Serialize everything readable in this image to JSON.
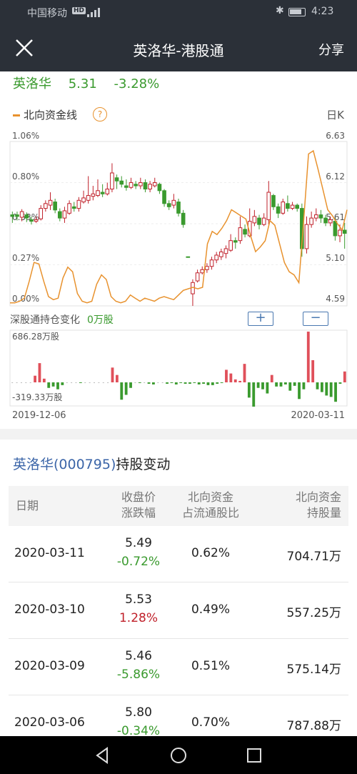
{
  "status_bar": {
    "carrier": "中国移动",
    "hd": "HD",
    "time": "4:23"
  },
  "nav": {
    "title": "英洛华-港股通",
    "share": "分享"
  },
  "quote": {
    "name": "英洛华",
    "price": "5.31",
    "change": "-3.28%"
  },
  "chart_header": {
    "line_label": "北向资金线",
    "help": "?",
    "period": "日K"
  },
  "colors": {
    "up": "#c0202a",
    "down": "#3a9a2e",
    "line": "#e8922e",
    "nav_bg": "#2b3038",
    "link": "#3b65a8"
  },
  "chart_data": [
    {
      "type": "candlestick",
      "left_axis_ticks": [
        "1.06%",
        "0.80%",
        "0.53%",
        "0.27%",
        "0.00%"
      ],
      "right_axis_ticks": [
        "6.63",
        "6.12",
        "5.61",
        "5.10",
        "4.59"
      ],
      "candles": [
        [
          5.7,
          5.72,
          5.62,
          5.76,
          -1
        ],
        [
          5.72,
          5.7,
          5.65,
          5.76,
          -1
        ],
        [
          5.69,
          5.76,
          5.64,
          5.79,
          1
        ],
        [
          5.72,
          5.68,
          5.63,
          5.75,
          -1
        ],
        [
          5.66,
          5.64,
          5.6,
          5.7,
          -1
        ],
        [
          5.64,
          5.66,
          5.62,
          5.7,
          1
        ],
        [
          5.67,
          5.8,
          5.65,
          5.84,
          1
        ],
        [
          5.8,
          5.86,
          5.76,
          5.9,
          1
        ],
        [
          5.84,
          5.9,
          5.78,
          6.0,
          1
        ],
        [
          5.88,
          5.78,
          5.74,
          5.92,
          -1
        ],
        [
          5.76,
          5.68,
          5.64,
          5.8,
          -1
        ],
        [
          5.68,
          5.77,
          5.62,
          5.82,
          1
        ],
        [
          5.74,
          5.86,
          5.72,
          5.9,
          1
        ],
        [
          5.82,
          5.8,
          5.76,
          5.88,
          -1
        ],
        [
          5.8,
          5.9,
          5.76,
          5.94,
          1
        ],
        [
          5.88,
          5.93,
          5.86,
          6.02,
          1
        ],
        [
          5.9,
          5.96,
          5.86,
          6.2,
          1
        ],
        [
          5.95,
          5.98,
          5.9,
          6.08,
          1
        ],
        [
          5.96,
          6.02,
          5.94,
          6.16,
          1
        ],
        [
          6.0,
          5.98,
          5.94,
          6.1,
          -1
        ],
        [
          5.98,
          6.04,
          5.96,
          6.12,
          1
        ],
        [
          6.04,
          6.24,
          6.0,
          6.36,
          1
        ],
        [
          6.18,
          6.14,
          6.04,
          6.22,
          -1
        ],
        [
          6.14,
          6.1,
          6.06,
          6.2,
          -1
        ],
        [
          6.08,
          6.06,
          6.02,
          6.16,
          -1
        ],
        [
          6.06,
          6.12,
          6.04,
          6.18,
          1
        ],
        [
          6.1,
          6.08,
          6.04,
          6.14,
          -1
        ],
        [
          6.08,
          6.12,
          6.04,
          6.18,
          1
        ],
        [
          6.12,
          6.04,
          6.0,
          6.16,
          -1
        ],
        [
          6.04,
          6.1,
          6.0,
          6.14,
          1
        ],
        [
          6.08,
          6.12,
          6.06,
          6.18,
          1
        ],
        [
          6.1,
          6.02,
          5.98,
          6.12,
          -1
        ],
        [
          6.02,
          5.86,
          5.82,
          6.04,
          -1
        ],
        [
          5.86,
          5.82,
          5.78,
          5.9,
          -1
        ],
        [
          5.84,
          5.9,
          5.8,
          5.98,
          1
        ],
        [
          5.88,
          5.74,
          5.7,
          5.92,
          -1
        ],
        [
          5.74,
          5.6,
          5.56,
          5.78,
          -1
        ],
        [
          5.2,
          5.2,
          5.2,
          5.2,
          0
        ],
        [
          4.74,
          4.88,
          4.59,
          4.92,
          1
        ],
        [
          4.9,
          5.0,
          4.88,
          5.04,
          1
        ],
        [
          5.0,
          5.04,
          4.98,
          5.08,
          1
        ],
        [
          5.04,
          5.08,
          5.0,
          5.12,
          1
        ],
        [
          5.08,
          5.16,
          5.04,
          5.2,
          1
        ],
        [
          5.16,
          5.22,
          5.12,
          5.26,
          1
        ],
        [
          5.2,
          5.26,
          5.16,
          5.3,
          1
        ],
        [
          5.24,
          5.3,
          5.18,
          5.34,
          1
        ],
        [
          5.28,
          5.4,
          5.26,
          5.48,
          1
        ],
        [
          5.38,
          5.4,
          5.3,
          5.44,
          -1
        ],
        [
          5.4,
          5.56,
          5.36,
          5.7,
          1
        ],
        [
          5.54,
          5.48,
          5.44,
          5.6,
          -1
        ],
        [
          5.46,
          5.64,
          5.44,
          5.8,
          1
        ],
        [
          5.62,
          5.7,
          5.58,
          5.78,
          1
        ],
        [
          5.68,
          5.6,
          5.54,
          5.72,
          -1
        ],
        [
          5.6,
          5.68,
          5.58,
          5.74,
          1
        ],
        [
          5.66,
          6.0,
          5.6,
          6.14,
          1
        ],
        [
          5.96,
          5.82,
          5.78,
          5.98,
          -1
        ],
        [
          5.82,
          5.74,
          5.68,
          5.86,
          -1
        ],
        [
          5.74,
          5.88,
          5.72,
          5.92,
          1
        ],
        [
          5.86,
          5.8,
          5.76,
          5.96,
          -1
        ],
        [
          5.8,
          5.84,
          5.78,
          5.88,
          1
        ],
        [
          5.84,
          5.8,
          5.76,
          5.86,
          -1
        ],
        [
          5.8,
          5.3,
          5.2,
          5.86,
          -1
        ],
        [
          5.3,
          5.6,
          5.24,
          5.7,
          1
        ],
        [
          5.6,
          5.68,
          5.56,
          5.76,
          1
        ],
        [
          5.68,
          5.72,
          5.64,
          5.8,
          1
        ],
        [
          5.72,
          5.68,
          5.62,
          5.78,
          -1
        ],
        [
          5.68,
          5.62,
          5.58,
          5.72,
          -1
        ],
        [
          5.62,
          5.66,
          5.58,
          5.7,
          1
        ],
        [
          5.64,
          5.46,
          5.4,
          5.68,
          -1
        ],
        [
          5.46,
          5.53,
          5.38,
          5.6,
          1
        ],
        [
          5.53,
          5.49,
          5.3,
          5.62,
          -1
        ]
      ],
      "line": [
        0.02,
        0.02,
        0.03,
        0.05,
        0.16,
        0.28,
        0.27,
        0.16,
        0.06,
        0.04,
        0.05,
        0.18,
        0.25,
        0.22,
        0.08,
        0.03,
        0.02,
        0.03,
        0.14,
        0.2,
        0.17,
        0.06,
        0.03,
        0.02,
        0.03,
        0.07,
        0.05,
        0.03,
        0.05,
        0.04,
        0.03,
        0.05,
        0.06,
        0.05,
        0.04,
        0.07,
        0.1,
        0.11,
        0.12,
        0.11,
        0.12,
        0.4,
        0.48,
        0.46,
        0.5,
        0.55,
        0.62,
        0.6,
        0.58,
        0.56,
        0.45,
        0.35,
        0.38,
        0.42,
        0.55,
        0.52,
        0.4,
        0.28,
        0.22,
        0.2,
        0.15,
        0.55,
        0.98,
        1.0,
        0.88,
        0.75,
        0.62,
        0.58,
        0.53,
        0.49,
        0.62
      ],
      "xmin_date": "2019-12-06",
      "xmax_date": "2020-03-11"
    },
    {
      "type": "bar",
      "ymax_label": "686.28万股",
      "ymin_label": "-319.33万股",
      "values": [
        0,
        0,
        0,
        0,
        0,
        90,
        260,
        50,
        -80,
        -60,
        -100,
        -40,
        0,
        0,
        0,
        -10,
        0,
        0,
        0,
        0,
        0,
        0,
        200,
        100,
        -250,
        -180,
        -80,
        0,
        -10,
        0,
        -20,
        -30,
        0,
        0,
        -20,
        -10,
        -30,
        -10,
        -20,
        -20,
        -10,
        -30,
        -20,
        -40,
        -40,
        -20,
        -10,
        170,
        120,
        40,
        20,
        250,
        -220,
        -350,
        -80,
        -100,
        -160,
        100,
        -60,
        -60,
        -30,
        -120,
        -50,
        -240,
        -100,
        686,
        300,
        -100,
        -140,
        -190,
        -210,
        -280,
        -20,
        147
      ]
    }
  ],
  "hold_change": {
    "label": "深股通持仓变化",
    "value": "0万股",
    "plus": "+",
    "minus": "−"
  },
  "table": {
    "heading_name": "英洛华(000795)",
    "heading_suffix": "持股变动",
    "headers": {
      "date": "日期",
      "price_line1": "收盘价",
      "price_line2": "涨跌幅",
      "ratio_line1": "北向资金",
      "ratio_line2": "占流通股比",
      "hold_line1": "北向资金",
      "hold_line2": "持股量"
    },
    "rows": [
      {
        "date": "2020-03-11",
        "price": "5.49",
        "pct": "-0.72%",
        "ratio": "0.62%",
        "hold": "704.71万",
        "dir": "neg"
      },
      {
        "date": "2020-03-10",
        "price": "5.53",
        "pct": "1.28%",
        "ratio": "0.49%",
        "hold": "557.25万",
        "dir": "pos"
      },
      {
        "date": "2020-03-09",
        "price": "5.46",
        "pct": "-5.86%",
        "ratio": "0.51%",
        "hold": "575.14万",
        "dir": "neg"
      },
      {
        "date": "2020-03-06",
        "price": "5.80",
        "pct": "-0.34%",
        "ratio": "0.70%",
        "hold": "787.88万",
        "dir": "neg"
      }
    ]
  }
}
